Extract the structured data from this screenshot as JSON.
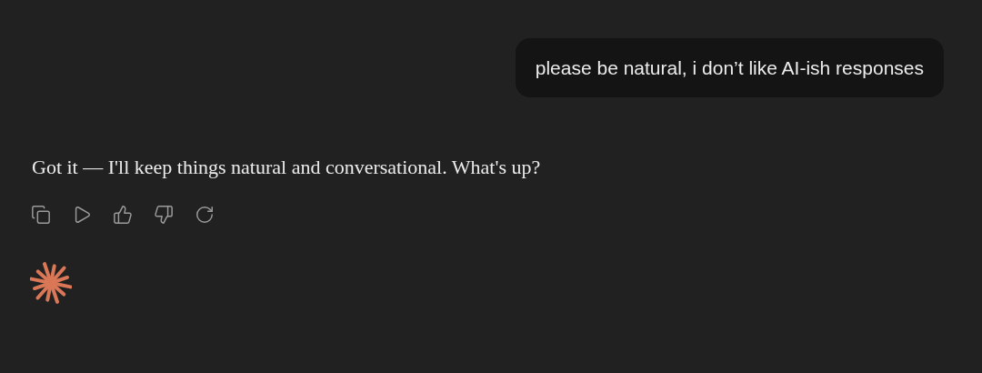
{
  "user_message": {
    "text": "please be natural, i don’t like AI-ish responses"
  },
  "assistant_message": {
    "text": "Got it — I'll keep things natural and conversational. What's up?"
  },
  "actions": [
    {
      "kind": "copy"
    },
    {
      "kind": "read_aloud"
    },
    {
      "kind": "thumbs_up"
    },
    {
      "kind": "thumbs_down"
    },
    {
      "kind": "retry"
    }
  ]
}
